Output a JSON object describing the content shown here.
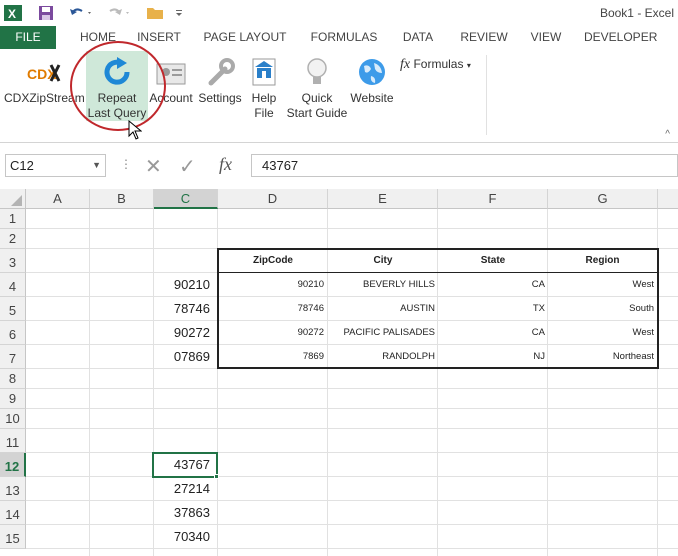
{
  "window": {
    "title": "Book1 - Excel"
  },
  "tabs": [
    {
      "label": "FILE"
    },
    {
      "label": "HOME"
    },
    {
      "label": "INSERT"
    },
    {
      "label": "PAGE LAYOUT"
    },
    {
      "label": "FORMULAS"
    },
    {
      "label": "DATA"
    },
    {
      "label": "REVIEW"
    },
    {
      "label": "VIEW"
    },
    {
      "label": "DEVELOPER"
    }
  ],
  "ribbon": {
    "cdx": {
      "line1": "CDXZipStream",
      "logo": "CDX"
    },
    "repeat": {
      "line1": "Repeat",
      "line2": "Last Query"
    },
    "account": {
      "line1": "Account"
    },
    "settings": {
      "line1": "Settings"
    },
    "help": {
      "line1": "Help",
      "line2": "File"
    },
    "quick": {
      "line1": "Quick",
      "line2": "Start Guide"
    },
    "website": {
      "line1": "Website"
    },
    "formulas": {
      "label": "Formulas",
      "fx": "fx"
    }
  },
  "formula_bar": {
    "name_box": "C12",
    "value": "43767",
    "fx": "fx"
  },
  "grid": {
    "columns": [
      "A",
      "B",
      "C",
      "D",
      "E",
      "F",
      "G"
    ],
    "rows": [
      "1",
      "2",
      "3",
      "4",
      "5",
      "6",
      "7",
      "8",
      "9",
      "10",
      "11",
      "12",
      "13",
      "14",
      "15"
    ],
    "selected_column": "C",
    "selected_row": "12",
    "col_c": {
      "r4": "90210",
      "r5": "78746",
      "r6": "90272",
      "r7": "07869",
      "r12": "43767",
      "r13": "27214",
      "r14": "37863",
      "r15": "70340"
    },
    "table": {
      "headers": [
        "ZipCode",
        "City",
        "State",
        "Region"
      ],
      "rows": [
        [
          "90210",
          "BEVERLY HILLS",
          "CA",
          "West"
        ],
        [
          "78746",
          "AUSTIN",
          "TX",
          "South"
        ],
        [
          "90272",
          "PACIFIC PALISADES",
          "CA",
          "West"
        ],
        [
          "7869",
          "RANDOLPH",
          "NJ",
          "Northeast"
        ]
      ]
    }
  },
  "colors": {
    "excel_green": "#217346",
    "highlight_circle": "#c0282c"
  }
}
